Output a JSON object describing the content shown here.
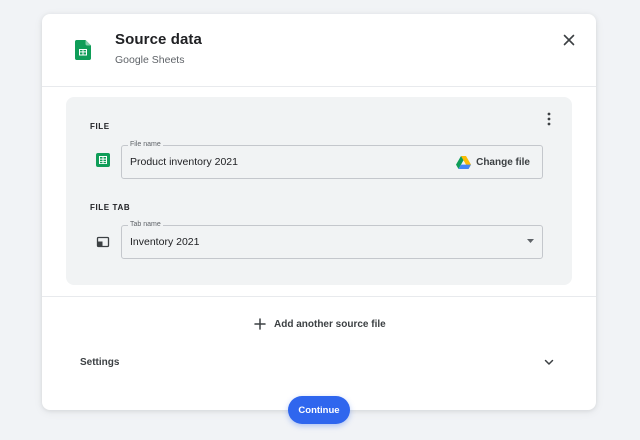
{
  "dialog": {
    "title": "Source data",
    "subtitle": "Google Sheets",
    "icon": "google-sheets-icon",
    "close_icon": "close-icon"
  },
  "source": {
    "menu_icon": "more-vert-icon",
    "file_section": {
      "label": "FILE",
      "icon": "google-sheets-icon",
      "field_label": "File name",
      "value": "Product inventory 2021",
      "action_icon": "google-drive-icon",
      "action_label": "Change file"
    },
    "tab_section": {
      "label": "FILE TAB",
      "icon": "tab-icon",
      "field_label": "Tab name",
      "value": "Inventory 2021",
      "dropdown_icon": "dropdown-arrow-icon"
    }
  },
  "add_source": {
    "icon": "plus-icon",
    "label": "Add another source file"
  },
  "settings": {
    "label": "Settings",
    "icon": "chevron-down-icon"
  },
  "continue": {
    "label": "Continue"
  },
  "colors": {
    "page_background": "#f1f3f6",
    "card_background": "#f1f3f4",
    "primary_button": "#2f66ee",
    "sheets_green": "#0f9d58"
  }
}
